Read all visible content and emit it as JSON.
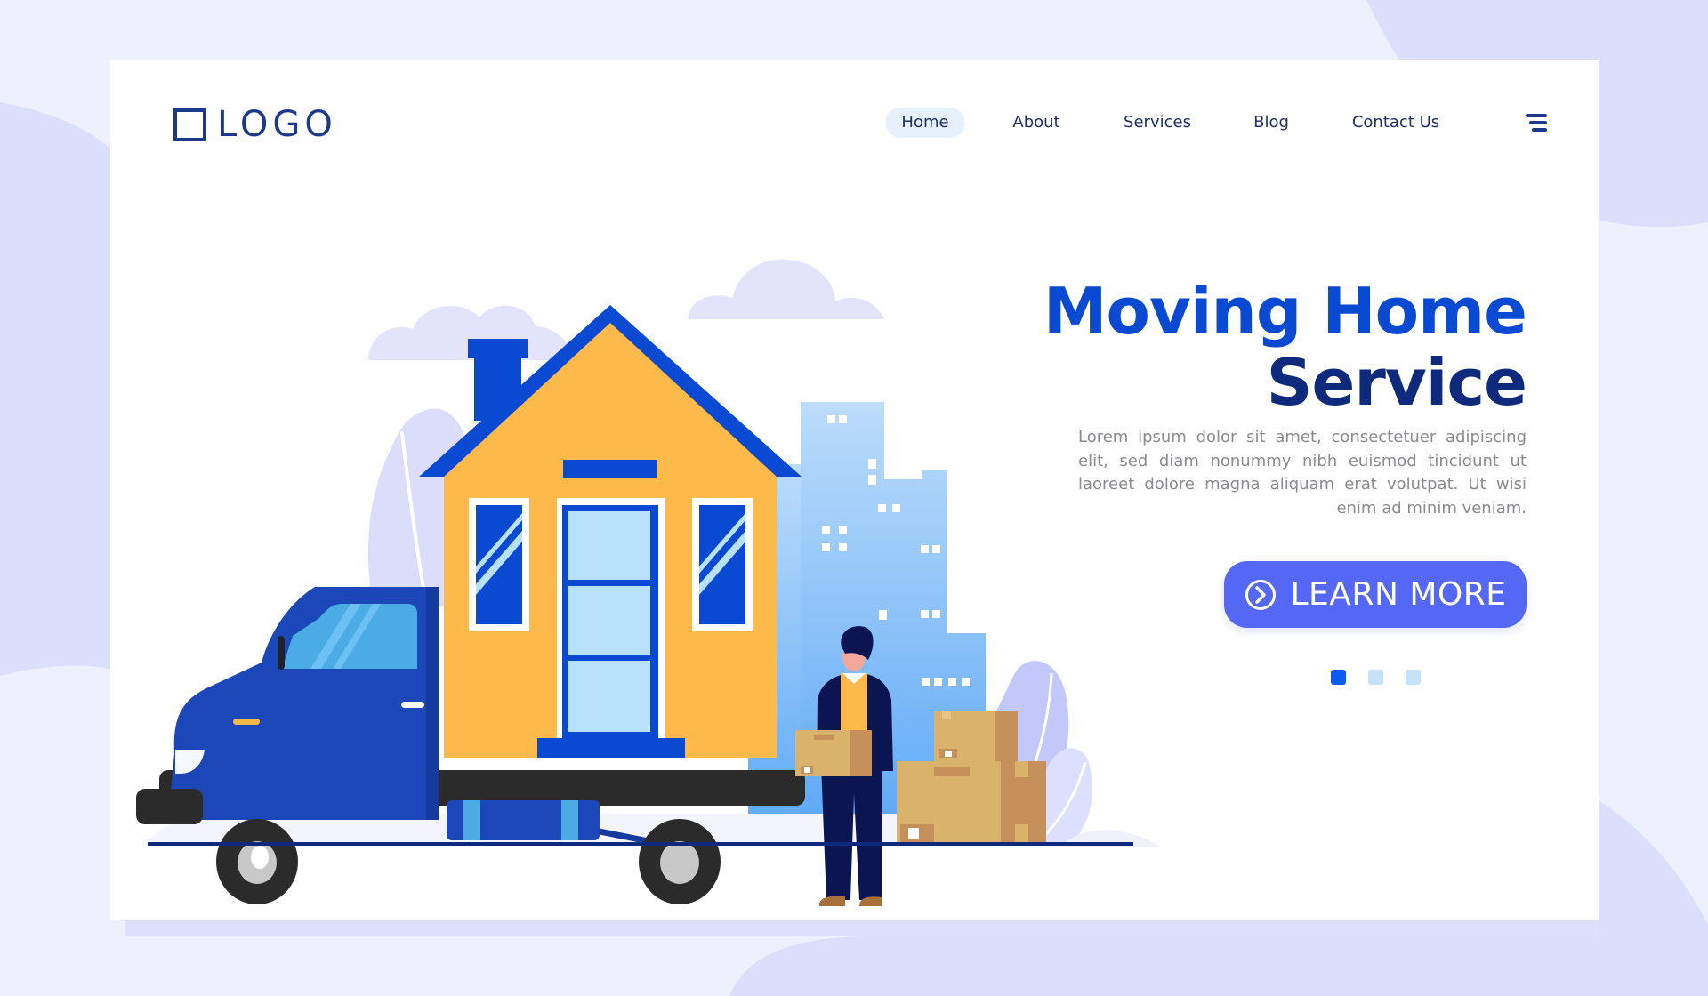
{
  "header": {
    "logo_text": "LOGO",
    "nav": [
      {
        "label": "Home",
        "active": true
      },
      {
        "label": "About",
        "active": false
      },
      {
        "label": "Services",
        "active": false
      },
      {
        "label": "Blog",
        "active": false
      },
      {
        "label": "Contact Us",
        "active": false
      }
    ],
    "menu_icon": "hamburger-menu-icon"
  },
  "hero": {
    "title_line1": "Moving Home",
    "title_line2": "Service",
    "description": "Lorem ipsum dolor sit amet, consectetuer adipiscing elit, sed diam nonummy nibh euismod tincidunt ut laoreet dolore magna aliquam erat volutpat. Ut wisi enim ad minim veniam.",
    "cta_label": "LEARN MORE",
    "cta_icon": "arrow-right-circle-icon"
  },
  "carousel": {
    "slides": 3,
    "active_index": 0
  },
  "colors": {
    "brand_dark": "#0e2a7d",
    "brand_blue": "#0a4ad2",
    "cta": "#5468f5",
    "dot_active": "#0a5cf5",
    "dot_inactive": "#c5e2f8",
    "house": "#fdb94a",
    "background": "#eef0fd"
  },
  "illustration": {
    "subject": "moving truck carrying house, mover holding box, city skyline"
  }
}
